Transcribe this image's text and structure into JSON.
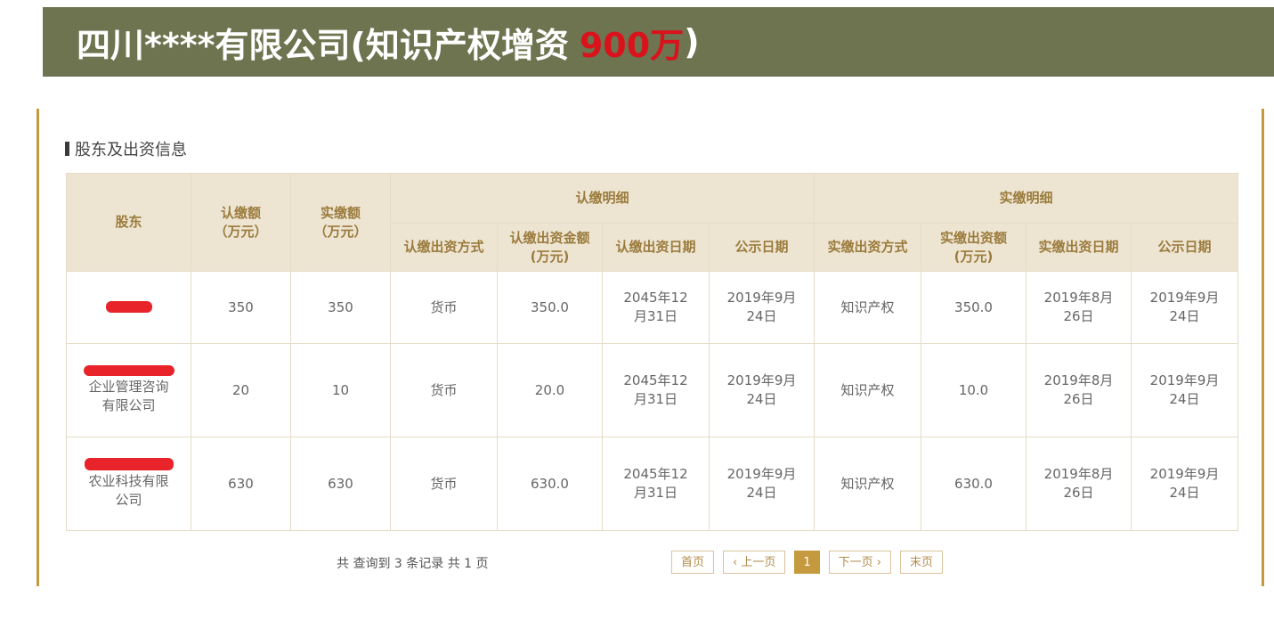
{
  "banner": {
    "title": "四川****有限公司(知识产权增资",
    "amount": "900万",
    "close_paren": ")"
  },
  "section_title": "股东及出资信息",
  "table": {
    "headers": {
      "shareholder": "股东",
      "subscribed_amount": "认缴额\n（万元）",
      "paid_amount": "实缴额\n（万元）",
      "subscribed_detail": "认缴明细",
      "paid_detail": "实缴明细",
      "sub_method": "认缴出资方式",
      "sub_total": "认缴出资金额\n(万元)",
      "sub_date": "认缴出资日期",
      "sub_publish": "公示日期",
      "paid_method": "实缴出资方式",
      "paid_total": "实缴出资额\n(万元)",
      "paid_date": "实缴出资日期",
      "paid_publish": "公示日期"
    },
    "rows": [
      {
        "shareholder": "",
        "subscribed": "350",
        "paid": "350",
        "sub_method": "货币",
        "sub_total": "350.0",
        "sub_date": "2045年12\n月31日",
        "sub_publish": "2019年9月\n24日",
        "paid_method": "知识产权",
        "paid_total": "350.0",
        "paid_date": "2019年8月\n26日",
        "paid_publish": "2019年9月\n24日"
      },
      {
        "shareholder": "企业管理咨询\n有限公司",
        "subscribed": "20",
        "paid": "10",
        "sub_method": "货币",
        "sub_total": "20.0",
        "sub_date": "2045年12\n月31日",
        "sub_publish": "2019年9月\n24日",
        "paid_method": "知识产权",
        "paid_total": "10.0",
        "paid_date": "2019年8月\n26日",
        "paid_publish": "2019年9月\n24日"
      },
      {
        "shareholder": "农业科技有限\n公司",
        "subscribed": "630",
        "paid": "630",
        "sub_method": "货币",
        "sub_total": "630.0",
        "sub_date": "2045年12\n月31日",
        "sub_publish": "2019年9月\n24日",
        "paid_method": "知识产权",
        "paid_total": "630.0",
        "paid_date": "2019年8月\n26日",
        "paid_publish": "2019年9月\n24日"
      }
    ]
  },
  "pager": {
    "info": "共 查询到 3 条记录 共 1 页",
    "first": "首页",
    "prev": "‹ 上一页",
    "current": "1",
    "next": "下一页 ›",
    "last": "末页"
  },
  "colors": {
    "banner_bg": "#6e7450",
    "accent_red": "#d9121b",
    "gold_border": "#c59a3e",
    "header_bg": "#ede5d2",
    "header_text": "#9b7b3d",
    "redaction": "#e8232a"
  }
}
